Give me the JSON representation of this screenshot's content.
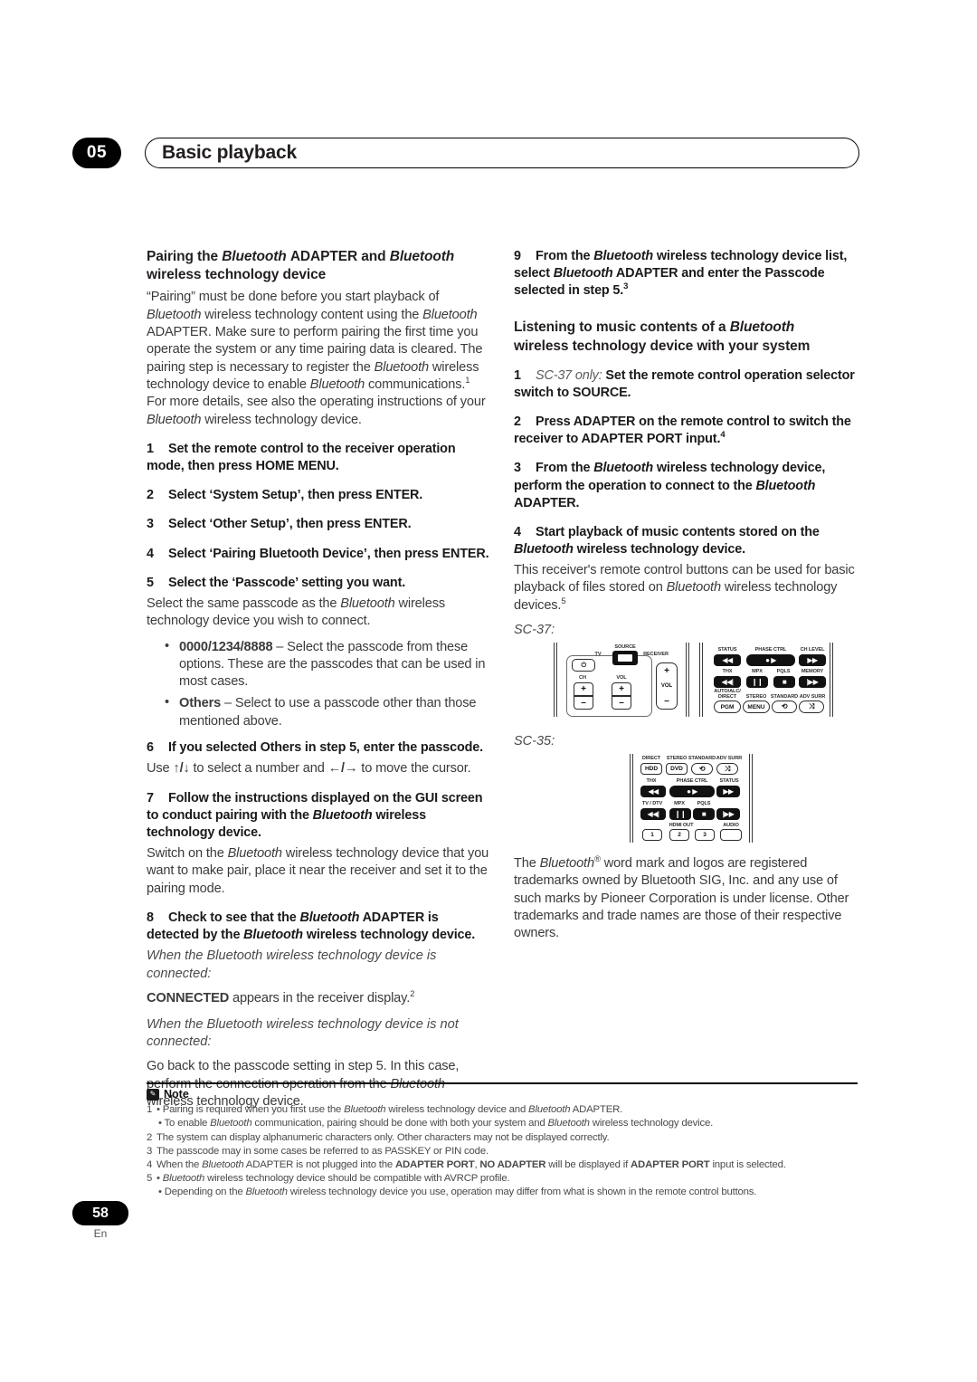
{
  "header": {
    "chapter_number": "05",
    "title": "Basic playback"
  },
  "left_column": {
    "section_title_line1": "Pairing the Bluetooth ADAPTER and Bluetooth",
    "section_title_line2": "wireless technology device",
    "intro": "“Pairing” must be done before you start playback of Bluetooth wireless technology content using the Bluetooth ADAPTER. Make sure to perform pairing the first time you operate the system or any time pairing data is cleared. The pairing step is necessary to register the Bluetooth wireless technology device to enable Bluetooth communications.1 For more details, see also the operating instructions of your Bluetooth wireless technology device.",
    "step1_num": "1",
    "step1": "Set the remote control to the receiver operation mode, then press HOME MENU.",
    "step2_num": "2",
    "step2": "Select ‘System Setup’, then press ENTER.",
    "step3_num": "3",
    "step3": "Select ‘Other Setup’, then press ENTER.",
    "step4_num": "4",
    "step4": "Select ‘Pairing Bluetooth Device’, then press ENTER.",
    "step5_num": "5",
    "step5": "Select the ‘Passcode’ setting you want.",
    "step5_body": "Select the same passcode as the Bluetooth wireless technology device you wish to connect.",
    "bullet1_bold": "0000/1234/8888",
    "bullet1_rest": " – Select the passcode from these options. These are the passcodes that can be used in most cases.",
    "bullet2_bold": "Others",
    "bullet2_rest": " – Select to use a passcode other than those mentioned above.",
    "step6_num": "6",
    "step6": "If you selected Others in step 5, enter the passcode.",
    "step6_body_pre": "Use ",
    "step6_arrows_1": "↑/↓",
    "step6_body_mid": " to select a number and ",
    "step6_arrows_2": "←/→",
    "step6_body_post": " to move the cursor.",
    "step7_num": "7",
    "step7": "Follow the instructions displayed on the GUI screen to conduct pairing with the Bluetooth wireless technology device.",
    "step7_body": "Switch on the Bluetooth wireless technology device that you want to make pair, place it near the receiver and set it to the pairing mode.",
    "step8_num": "8",
    "step8": "Check to see that the Bluetooth ADAPTER is detected by the Bluetooth wireless technology device.",
    "step8_italic_connected": "When the Bluetooth wireless technology device is connected:",
    "step8_connected_bold": "CONNECTED",
    "step8_connected_rest": " appears in the receiver display.2",
    "step8_italic_not_connected": "When the Bluetooth wireless technology device is not connected:",
    "step8_not_connected_body": "Go back to the passcode setting in step 5. In this case, perform the connection operation from the Bluetooth wireless technology device."
  },
  "right_column": {
    "step9_num": "9",
    "step9": "From the Bluetooth wireless technology device list, select Bluetooth ADAPTER and enter the Passcode selected in step 5.3",
    "section_title_line1": "Listening to music contents of a Bluetooth",
    "section_title_line2": "wireless technology device with your system",
    "step1_num": "1",
    "step1_italic": "SC-37 only:",
    "step1": " Set the remote control operation selector switch to SOURCE.",
    "step2_num": "2",
    "step2": "Press ADAPTER on the remote control to switch the receiver to ADAPTER PORT input.4",
    "step3_num": "3",
    "step3": "From the Bluetooth wireless technology device, perform the operation to connect to the Bluetooth ADAPTER.",
    "step4_num": "4",
    "step4": "Start playback of music contents stored on the Bluetooth wireless technology device.",
    "step4_body": "This receiver's remote control buttons can be used for basic playback of files stored on Bluetooth wireless technology devices.5",
    "caption_sc37": "SC-37:",
    "caption_sc35": "SC-35:",
    "trademark": "The Bluetooth® word mark and logos are registered trademarks owned by Bluetooth SIG, Inc. and any use of such marks by Pioneer Corporation is under license. Other trademarks and trade names are those of their respective owners."
  },
  "remote_sc37": {
    "left_panel": {
      "source_label": "SOURCE",
      "tv_label": "TV",
      "receiver_label": "RECEIVER",
      "power_glyph": "⏻",
      "ch_label": "CH",
      "vol_label": "VOL",
      "vol_right_label": "VOL",
      "plus": "+",
      "minus": "–"
    },
    "right_panel": {
      "labels_row1": [
        "STATUS",
        "PHASE CTRL",
        "CH LEVEL"
      ],
      "labels_row2": [
        "THX",
        "MPX",
        "PQLS",
        "MEMORY"
      ],
      "labels_row3": [
        "AUTO/ALC/ DIRECT",
        "STEREO",
        "STANDARD",
        "ADV SURR"
      ],
      "buttons_row1": [
        "◀◀",
        "●  ▶",
        "▶▶"
      ],
      "buttons_row2": [
        "◀◀|",
        "❙❙",
        "■",
        "|▶▶"
      ],
      "buttons_row3": [
        "PGM",
        "MENU",
        "⟲",
        "⤨"
      ]
    }
  },
  "remote_sc35": {
    "labels_row1": [
      "DIRECT",
      "STEREO",
      "STANDARD",
      "ADV SURR"
    ],
    "buttons_row1": [
      "HDD",
      "DVD",
      "⟲",
      "⤨"
    ],
    "labels_row2": [
      "THX",
      "PHASE CTRL",
      "STATUS"
    ],
    "buttons_row2": [
      "◀◀",
      "●  ▶",
      "▶▶"
    ],
    "labels_row3": [
      "TV / DTV",
      "MPX",
      "PQLS"
    ],
    "buttons_row3": [
      "◀◀|",
      "❙❙",
      "■",
      "|▶▶"
    ],
    "labels_row4": [
      "HDMI OUT",
      "AUDIO"
    ],
    "buttons_row4": [
      "1",
      "2",
      "3",
      ""
    ]
  },
  "notes": {
    "heading": "Note",
    "icon": "pencil-icon",
    "items": [
      {
        "num": "1",
        "bullet": "•",
        "text": "Pairing is required when you first use the Bluetooth wireless technology device and Bluetooth ADAPTER."
      },
      {
        "num": "",
        "bullet": "•",
        "text": "To enable Bluetooth communication, pairing should be done with both your system and Bluetooth wireless technology device."
      },
      {
        "num": "2",
        "bullet": "",
        "text": "The system can display alphanumeric characters only. Other characters may not be displayed correctly."
      },
      {
        "num": "3",
        "bullet": "",
        "text": "The passcode may in some cases be referred to as PASSKEY or PIN code."
      },
      {
        "num": "4",
        "bullet": "",
        "text": "When the Bluetooth ADAPTER is not plugged into the ADAPTER PORT, NO ADAPTER will be displayed if ADAPTER PORT input is selected."
      },
      {
        "num": "5",
        "bullet": "•",
        "text": "Bluetooth wireless technology device should be compatible with AVRCP profile."
      },
      {
        "num": "",
        "bullet": "•",
        "text": "Depending on the Bluetooth wireless technology device you use, operation may differ from what is shown in the remote control buttons."
      }
    ]
  },
  "footer": {
    "page_number": "58",
    "language": "En"
  }
}
